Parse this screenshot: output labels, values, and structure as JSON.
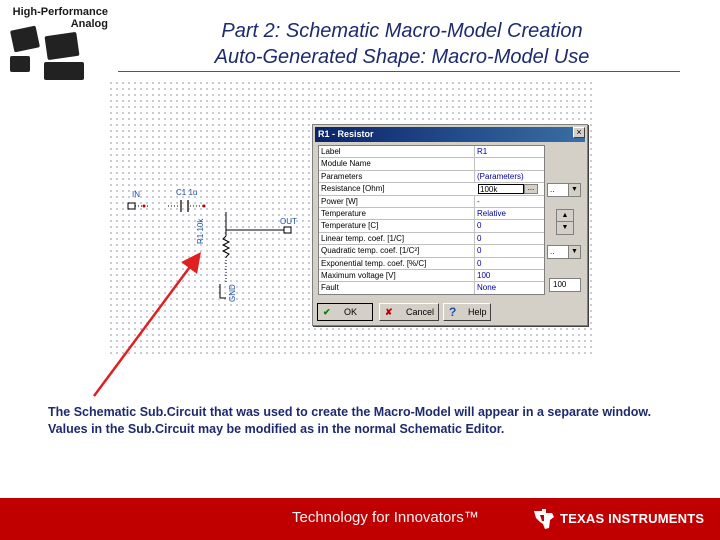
{
  "logo": {
    "line1": "High-Performance",
    "line2": "Analog"
  },
  "header": {
    "title_line1": "Part 2: Schematic Macro-Model Creation",
    "title_line2": "Auto-Generated Shape: Macro-Model Use"
  },
  "schematic": {
    "in_label": "IN",
    "cap_label": "C1 1u",
    "res_label": "R1 10k",
    "out_label": "OUT",
    "gnd_label": "GND"
  },
  "dialog": {
    "title": "R1 - Resistor",
    "close_glyph": "×",
    "rows": [
      {
        "name": "Label",
        "value": "R1"
      },
      {
        "name": "Module Name",
        "value": ""
      },
      {
        "name": "Parameters",
        "value": "(Parameters)"
      },
      {
        "name": "Resistance [Ohm]",
        "value": "100k"
      },
      {
        "name": "Power      [W]",
        "value": "-"
      },
      {
        "name": "Temperature",
        "value": "Relative"
      },
      {
        "name": "Temperature [C]",
        "value": "0"
      },
      {
        "name": "Linear temp. coef. [1/C]",
        "value": "0"
      },
      {
        "name": "Quadratic temp. coef. [1/C²]",
        "value": "0"
      },
      {
        "name": "Exponential temp. coef. [%/C]",
        "value": "0"
      },
      {
        "name": "Maximum voltage [V]",
        "value": "100"
      },
      {
        "name": "Fault",
        "value": "None"
      }
    ],
    "edit_value": "100k",
    "edit_button_glyph": "...",
    "combo1_value": "..",
    "combo2_value": "..",
    "spin_up": "▲",
    "spin_down": "▼",
    "side_value": "100",
    "ok_label": "OK",
    "cancel_label": "Cancel",
    "help_label": "Help",
    "ok_icon": "✔",
    "cancel_icon": "✘",
    "help_icon": "?"
  },
  "caption": {
    "text": "The Schematic Sub.Circuit that was used to create the Macro-Model will appear in a separate window.  Values in the Sub.Circuit may be modified as in the normal Schematic Editor."
  },
  "footer": {
    "tagline": "Technology for Innovators™",
    "company": "TEXAS INSTRUMENTS"
  },
  "colors": {
    "title": "#1e2a6e",
    "footer_bg": "#c00000",
    "arrow": "#e02020",
    "dialog_title_bg": "#0a246a"
  }
}
